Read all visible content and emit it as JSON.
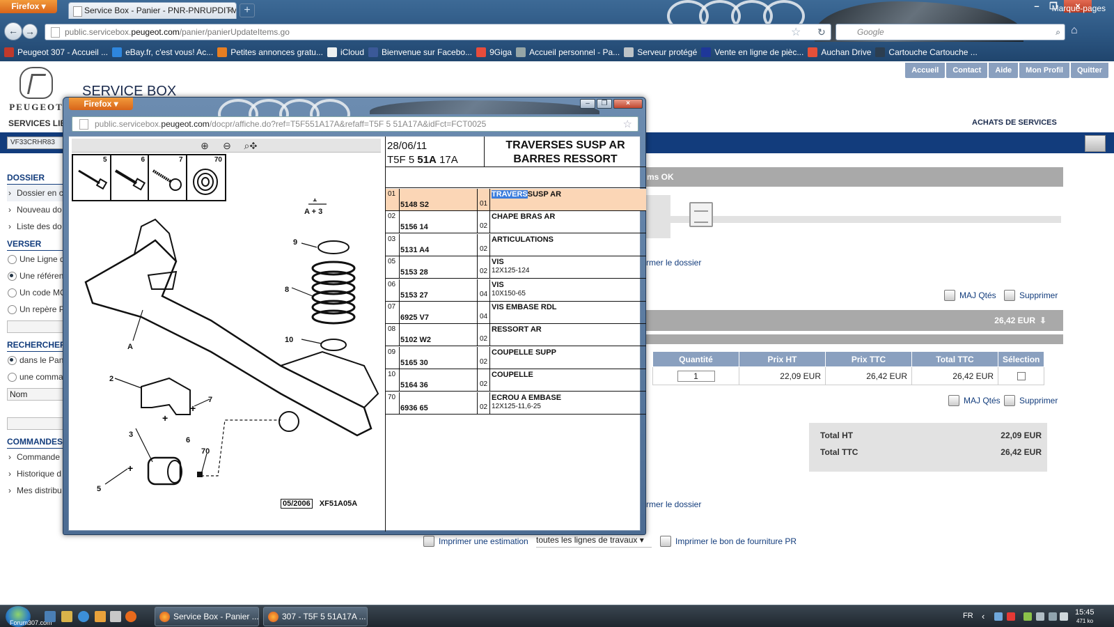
{
  "browser": {
    "menu_label": "Firefox",
    "tab_title": "Service Box - Panier - PNR-PNRUPDITM...",
    "url_prefix": "public.servicebox.",
    "url_domain": "peugeot.com",
    "url_path": "/panier/panierUpdateItems.go",
    "search_engine": "Google",
    "bookmarks": [
      {
        "label": "Peugeot 307 - Accueil ...",
        "color": "#c0392b"
      },
      {
        "label": "eBay.fr, c'est vous! Ac...",
        "color": "#2e86de"
      },
      {
        "label": "Petites annonces gratu...",
        "color": "#e67e22"
      },
      {
        "label": "iCloud",
        "color": "#ecf0f1"
      },
      {
        "label": "Bienvenue sur Facebo...",
        "color": "#3b5998"
      },
      {
        "label": "9Giga",
        "color": "#e74c3c"
      },
      {
        "label": "Accueil personnel - Pa...",
        "color": "#95a5a6"
      },
      {
        "label": "Serveur protégé",
        "color": "#bdc3c7"
      },
      {
        "label": "Vente en ligne de pièc...",
        "color": "#1e3799"
      },
      {
        "label": "Auchan Drive",
        "color": "#e55039"
      },
      {
        "label": "Cartouche Cartouche ...",
        "color": "#2c3e50"
      }
    ],
    "bookmarks_menu": "Marque-pages"
  },
  "page": {
    "brand": "PEUGEOT",
    "title": "SERVICE BOX",
    "top_buttons": [
      "Accueil",
      "Contact",
      "Aide",
      "Mon Profil",
      "Quitter"
    ],
    "services_label": "SERVICES LIB",
    "achats_label": "ACHATS DE SERVICES",
    "vin": "VF33CRHR83",
    "dossier": {
      "heading": "DOSSIER",
      "items": [
        "Dossier en c",
        "Nouveau do",
        "Liste des do"
      ]
    },
    "verser": {
      "heading": "VERSER",
      "items": [
        "Une Ligne d",
        "Une référen",
        "Un code MO",
        "Un repère P"
      ]
    },
    "rechercher": {
      "heading": "RECHERCHER",
      "items": [
        "dans le Pan",
        "une comma"
      ],
      "field_value": "Nom"
    },
    "commandes": {
      "heading": "COMMANDES",
      "items": [
        "Commande",
        "Historique d",
        "Mes distribu"
      ]
    },
    "status_text": "ms OK",
    "close_folder": "rmer le dossier",
    "maj_qtes": "MAJ Qtés",
    "supprimer": "Supprimer",
    "price_bar": "26,42 EUR",
    "cart": {
      "headers": [
        "Quantité",
        "Prix HT",
        "Prix TTC",
        "Total TTC",
        "Sélection"
      ],
      "row": {
        "qty": "1",
        "prix_ht": "22,09 EUR",
        "prix_ttc": "26,42 EUR",
        "total_ttc": "26,42 EUR"
      }
    },
    "totals": [
      {
        "label": "Total HT",
        "value": "22,09 EUR"
      },
      {
        "label": "Total TTC",
        "value": "26,42 EUR"
      }
    ],
    "print_estimate": "Imprimer une estimation",
    "lines_select": "toutes les lignes de travaux",
    "print_supply": "Imprimer le bon de fourniture PR"
  },
  "popup": {
    "menu_label": "Firefox",
    "url_prefix": "public.servicebox.",
    "url_domain": "peugeot.com",
    "url_path": "/docpr/affiche.do?ref=T5F551A17A&refaff=T5F 5 51A17A&idFct=FCT0025",
    "diagram": {
      "hardware_numbers": [
        "5",
        "6",
        "7",
        "70"
      ],
      "labels": [
        "1",
        "A + 3",
        "9",
        "8",
        "10",
        "A",
        "2",
        "7",
        "6",
        "3",
        "70",
        "5"
      ],
      "date_code": "05/2006",
      "ref_code": "XF51A05A"
    },
    "parts_header": {
      "date": "28/06/11",
      "ref_prefix": "T5F 5",
      "ref_bold": "51A",
      "ref_suffix": "17A",
      "title_line1": "TRAVERSES SUSP AR",
      "title_line2": "BARRES RESSORT"
    },
    "parts": [
      {
        "pos": "01",
        "ref": "5148 S2",
        "qty": "01",
        "desig_sel": "TRAVERS",
        "desig": "SUSP AR",
        "sub": ""
      },
      {
        "pos": "02",
        "ref": "5156 14",
        "qty": "02",
        "desig_sel": "",
        "desig": "CHAPE BRAS AR",
        "sub": ""
      },
      {
        "pos": "03",
        "ref": "5131 A4",
        "qty": "02",
        "desig_sel": "",
        "desig": "ARTICULATIONS",
        "sub": ""
      },
      {
        "pos": "05",
        "ref": "5153 28",
        "qty": "02",
        "desig_sel": "",
        "desig": "VIS",
        "sub": "12X125-124"
      },
      {
        "pos": "06",
        "ref": "5153 27",
        "qty": "04",
        "desig_sel": "",
        "desig": "VIS",
        "sub": "10X150-65"
      },
      {
        "pos": "07",
        "ref": "6925 V7",
        "qty": "04",
        "desig_sel": "",
        "desig": "VIS EMBASE RDL",
        "sub": ""
      },
      {
        "pos": "08",
        "ref": "5102 W2",
        "qty": "02",
        "desig_sel": "",
        "desig": "RESSORT AR",
        "sub": ""
      },
      {
        "pos": "09",
        "ref": "5165 30",
        "qty": "02",
        "desig_sel": "",
        "desig": "COUPELLE SUPP",
        "sub": ""
      },
      {
        "pos": "10",
        "ref": "5164 36",
        "qty": "02",
        "desig_sel": "",
        "desig": "COUPELLE",
        "sub": ""
      },
      {
        "pos": "70",
        "ref": "6936 65",
        "qty": "02",
        "desig_sel": "",
        "desig": "ECROU A EMBASE",
        "sub": "12X125-11,6-25"
      }
    ]
  },
  "taskbar": {
    "watermark": "Forum307.com",
    "tasks": [
      "Service Box - Panier ...",
      "307 - T5F 5 51A17A ..."
    ],
    "lang": "FR",
    "time": "15:45",
    "speed": "471 ko"
  }
}
